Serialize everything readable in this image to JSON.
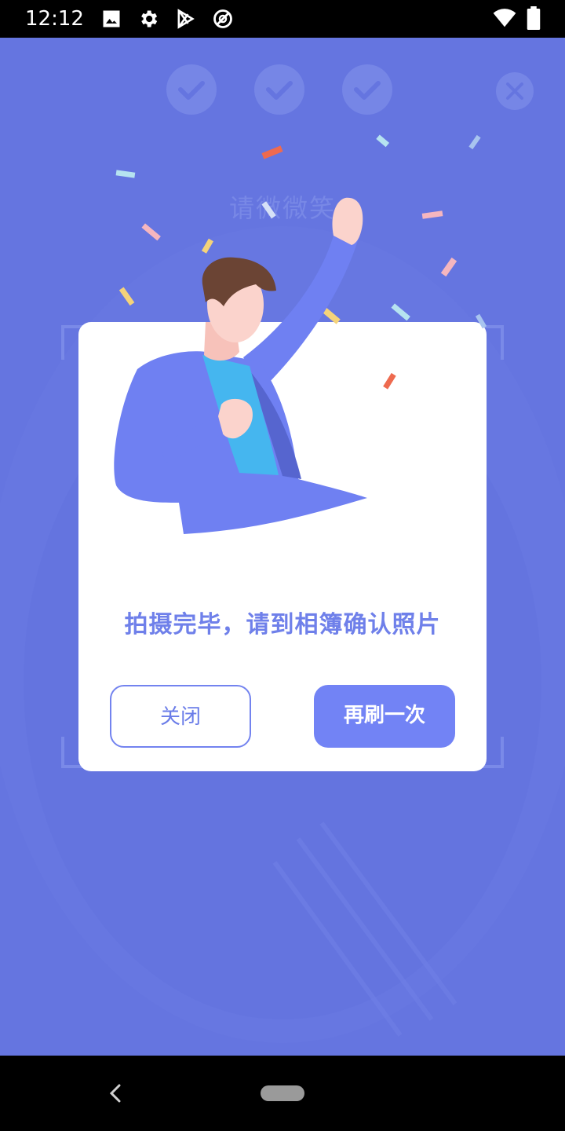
{
  "status_bar": {
    "time": "12:12",
    "left_icons": [
      "image-icon",
      "settings-icon",
      "play-store-icon",
      "location-off-icon"
    ],
    "right_icons": [
      "wifi-icon",
      "battery-icon"
    ]
  },
  "camera": {
    "prompt": "请微微笑",
    "completed_steps": 3
  },
  "dialog": {
    "message": "拍摄完毕，请到相簿确认照片",
    "close_label": "关闭",
    "retry_label": "再刷一次"
  },
  "colors": {
    "background": "#6575e0",
    "accent": "#7283f5",
    "message": "#6f80ea"
  }
}
